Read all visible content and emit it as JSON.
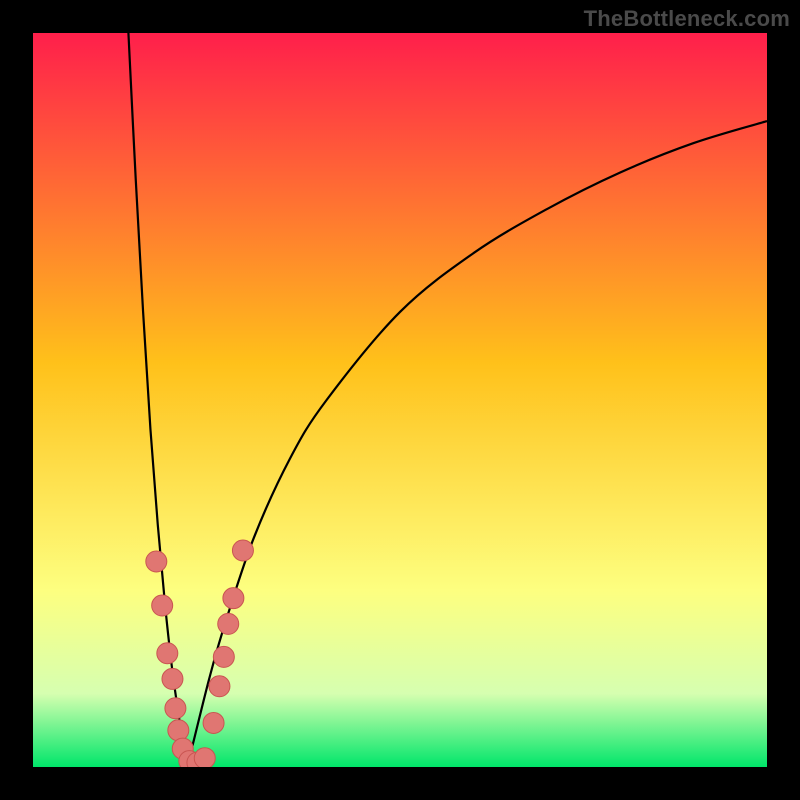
{
  "watermark": "TheBottleneck.com",
  "colors": {
    "frame": "#000000",
    "gradient_top": "#ff1f4b",
    "gradient_mid": "#ffc11a",
    "gradient_low1": "#fdff80",
    "gradient_low2": "#d6ffb0",
    "gradient_bottom": "#00e66a",
    "curve": "#000000",
    "dot_fill": "#e07672",
    "dot_stroke": "#c95551"
  },
  "chart_data": {
    "type": "line",
    "title": "",
    "xlabel": "",
    "ylabel": "",
    "xlim": [
      0,
      100
    ],
    "ylim": [
      0,
      100
    ],
    "curve": {
      "x_min_at": 21,
      "piecewise": "left branch descends steeply from (13,100) to (21,0); right branch rises concavely from (21,0) toward (100,88)"
    },
    "series": [
      {
        "name": "left-branch",
        "x": [
          13,
          14,
          15,
          16,
          17,
          18,
          19,
          20,
          20.5,
          21
        ],
        "y": [
          100,
          80,
          62,
          46,
          33,
          22,
          13,
          6,
          2,
          0
        ]
      },
      {
        "name": "right-branch",
        "x": [
          21,
          22,
          24,
          26,
          30,
          35,
          40,
          50,
          60,
          70,
          80,
          90,
          100
        ],
        "y": [
          0,
          4,
          12,
          19,
          31,
          42,
          50,
          62,
          70,
          76,
          81,
          85,
          88
        ]
      }
    ],
    "dots": [
      {
        "x": 16.8,
        "y": 28.0
      },
      {
        "x": 17.6,
        "y": 22.0
      },
      {
        "x": 18.3,
        "y": 15.5
      },
      {
        "x": 19.0,
        "y": 12.0
      },
      {
        "x": 19.4,
        "y": 8.0
      },
      {
        "x": 19.8,
        "y": 5.0
      },
      {
        "x": 20.4,
        "y": 2.5
      },
      {
        "x": 21.3,
        "y": 0.8
      },
      {
        "x": 22.4,
        "y": 0.6
      },
      {
        "x": 23.4,
        "y": 1.2
      },
      {
        "x": 24.6,
        "y": 6.0
      },
      {
        "x": 25.4,
        "y": 11.0
      },
      {
        "x": 26.0,
        "y": 15.0
      },
      {
        "x": 26.6,
        "y": 19.5
      },
      {
        "x": 27.3,
        "y": 23.0
      },
      {
        "x": 28.6,
        "y": 29.5
      }
    ]
  }
}
